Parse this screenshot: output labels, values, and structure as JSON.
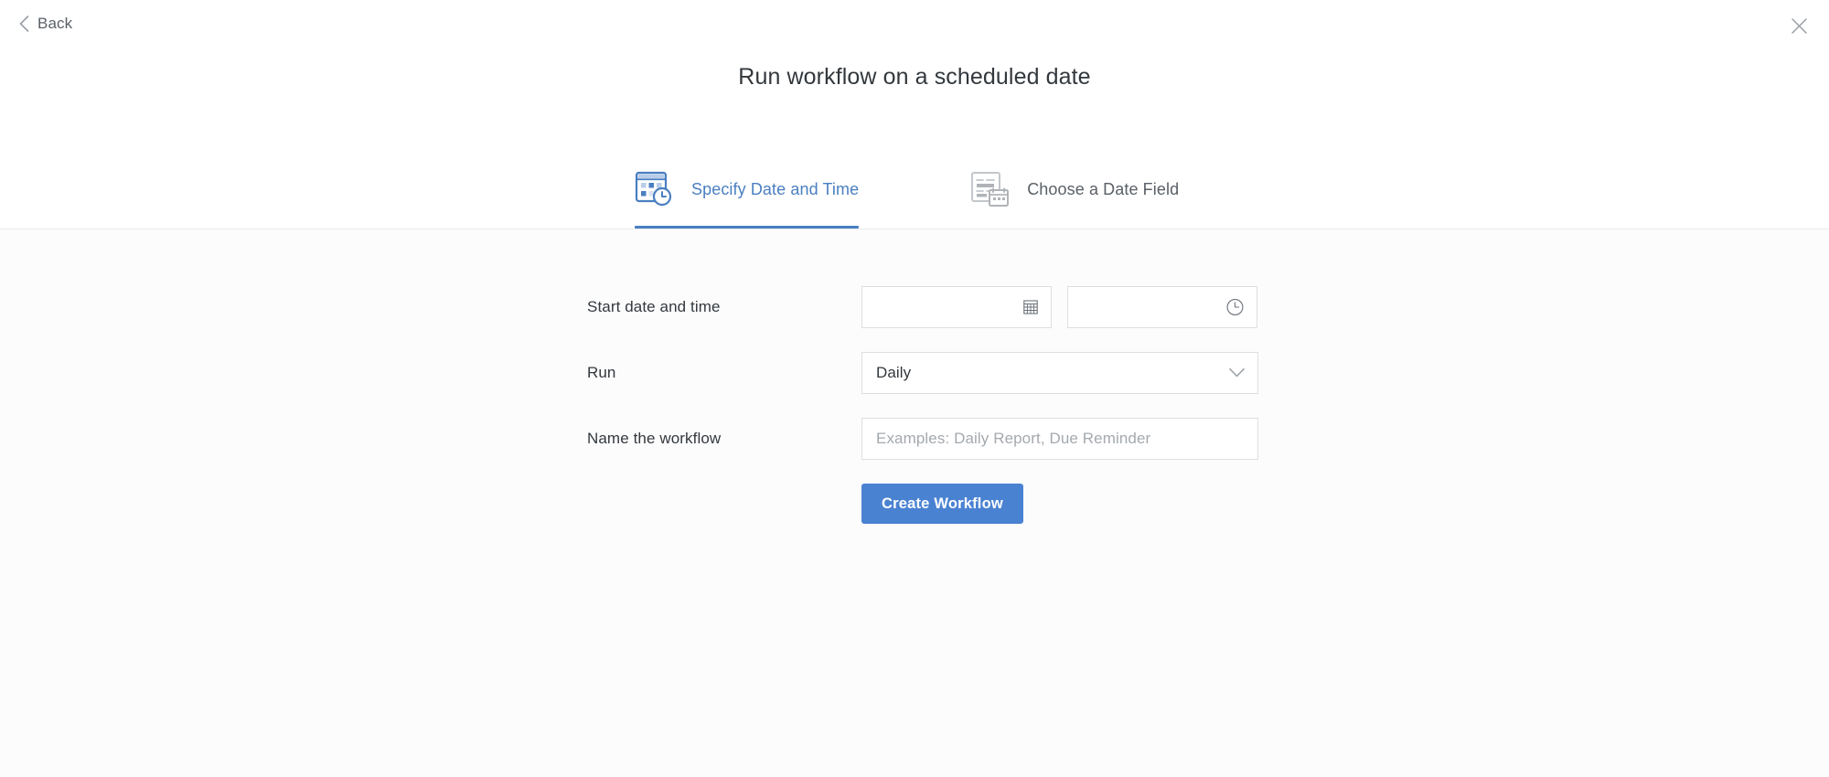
{
  "header": {
    "back_label": "Back",
    "back_icon": "chevron-left-icon",
    "close_icon": "close-icon",
    "title": "Run workflow on a scheduled date"
  },
  "tabs": [
    {
      "label": "Specify Date and Time",
      "icon": "calendar-clock-icon",
      "active": true
    },
    {
      "label": "Choose a Date Field",
      "icon": "form-calendar-icon",
      "active": false
    }
  ],
  "form": {
    "rows": [
      {
        "label": "Start date and time",
        "date_value": "",
        "date_placeholder": "",
        "date_icon": "calendar-icon",
        "time_value": "",
        "time_placeholder": "",
        "time_icon": "clock-icon"
      },
      {
        "label": "Run",
        "value": "Daily",
        "caret_icon": "chevron-down-icon",
        "options": [
          "Daily"
        ]
      },
      {
        "label": "Name the workflow",
        "value": "",
        "placeholder": "Examples: Daily Report, Due Reminder"
      }
    ],
    "submit_label": "Create Workflow"
  },
  "colors": {
    "accent": "#4a7fc1",
    "button": "#4a82d2",
    "text": "#33383d",
    "muted": "#a4a9ae",
    "border": "#dcdfe2",
    "body_bg": "#fcfcfd"
  }
}
